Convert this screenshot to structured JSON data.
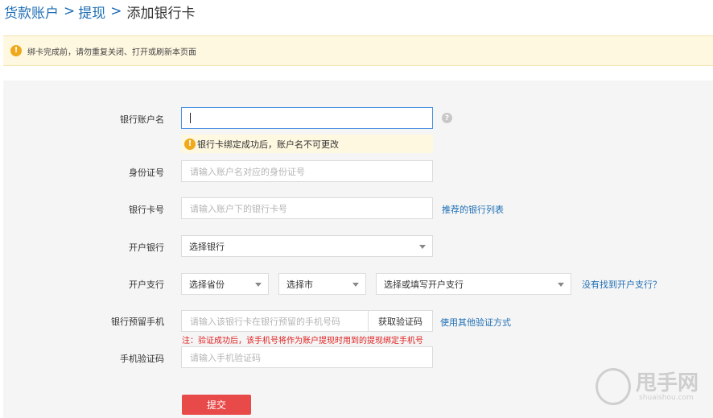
{
  "breadcrumb": {
    "account": "货款账户",
    "sep": ">",
    "withdraw": "提现",
    "current": "添加银行卡"
  },
  "notice": {
    "icon": "warning-icon",
    "text": "绑卡完成前，请勿重复关闭、打开或刷新本页面"
  },
  "form": {
    "account_name": {
      "label": "银行账户名",
      "value": "",
      "help": "?"
    },
    "tip": {
      "icon": "warning-icon",
      "text": "银行卡绑定成功后，账户名不可更改"
    },
    "id_number": {
      "label": "身份证号",
      "placeholder": "请输入账户名对应的身份证号"
    },
    "card_number": {
      "label": "银行卡号",
      "placeholder": "请输入账户下的银行卡号",
      "link": "推荐的银行列表"
    },
    "bank": {
      "label": "开户银行",
      "selected": "选择银行"
    },
    "branch": {
      "label": "开户支行",
      "province": "选择省份",
      "city": "选择市",
      "branch": "选择或填写开户支行",
      "link": "没有找到开户支行？"
    },
    "phone": {
      "label": "银行预留手机",
      "placeholder": "请输入该银行卡在银行预留的手机号码",
      "get_code": "获取验证码",
      "other_link": "使用其他验证方式",
      "note": "注：验证成功后，该手机号将作为账户提现时用到的提现绑定手机号"
    },
    "sms_code": {
      "label": "手机验证码",
      "placeholder": "请输入手机验证码"
    },
    "submit": "提交"
  },
  "watermark": {
    "text": "甩手网",
    "sub": "shuaishou.com"
  },
  "colors": {
    "link": "#1f6fb5",
    "warning": "#f1a81b",
    "submit": "#e84a4a",
    "note": "#e02020"
  }
}
